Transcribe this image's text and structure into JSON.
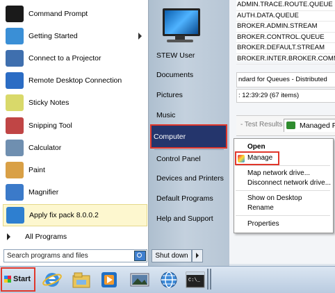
{
  "background_window": {
    "queue_names": [
      "ADMIN.TRACE.ROUTE.QUEUE",
      "AUTH.DATA.QUEUE",
      "BROKER.ADMIN.STREAM",
      "BROKER.CONTROL.QUEUE",
      "BROKER.DEFAULT.STREAM",
      "BROKER.INTER.BROKER.COMMUNI"
    ],
    "filter_text": "ndard for Queues - Distributed",
    "status_text": ": 12:39:29 (67 items)",
    "tab_test_results": "- Test Results",
    "tab_managed": "Managed Fi"
  },
  "start_menu": {
    "programs": [
      {
        "label": "Command Prompt",
        "icon": "command-prompt-icon",
        "color": "#1a1a1a"
      },
      {
        "label": "Getting Started",
        "icon": "getting-started-icon",
        "color": "#3a8fd6",
        "submenu": true
      },
      {
        "label": "Connect to a Projector",
        "icon": "projector-icon",
        "color": "#3f6fae"
      },
      {
        "label": "Remote Desktop Connection",
        "icon": "remote-desktop-icon",
        "color": "#2b6cc4"
      },
      {
        "label": "Sticky Notes",
        "icon": "sticky-notes-icon",
        "color": "#d9d96a"
      },
      {
        "label": "Snipping Tool",
        "icon": "scissors-icon",
        "color": "#c04545"
      },
      {
        "label": "Calculator",
        "icon": "calculator-icon",
        "color": "#6f8fb0"
      },
      {
        "label": "Paint",
        "icon": "paint-icon",
        "color": "#d9a046"
      },
      {
        "label": "Magnifier",
        "icon": "magnifier-icon",
        "color": "#3b7ac9"
      },
      {
        "label": "Apply fix pack 8.0.0.2",
        "icon": "fix-pack-icon",
        "color": "#2e7fd0",
        "highlighted": true
      }
    ],
    "all_programs": "All Programs",
    "search_placeholder": "Search programs and files",
    "right_items": [
      "STEW User",
      "Documents",
      "Pictures",
      "Music",
      "Computer",
      "Control Panel",
      "Devices and Printers",
      "Default Programs",
      "Help and Support"
    ],
    "active_item": "Computer",
    "shutdown_label": "Shut down"
  },
  "context_menu": {
    "items": [
      "Open",
      "Manage",
      "Map network drive...",
      "Disconnect network drive...",
      "Show on Desktop",
      "Rename",
      "Properties"
    ],
    "bold_item": "Open",
    "highlighted_item": "Manage"
  },
  "taskbar": {
    "start_label": "Start",
    "pinned": [
      "internet-explorer-icon",
      "windows-explorer-icon",
      "media-player-icon",
      "image-viewer-icon",
      "network-globe-icon",
      "command-prompt-icon"
    ]
  },
  "colors": {
    "highlight_box": "#e0362a",
    "active_item_bg": "#24356c"
  }
}
